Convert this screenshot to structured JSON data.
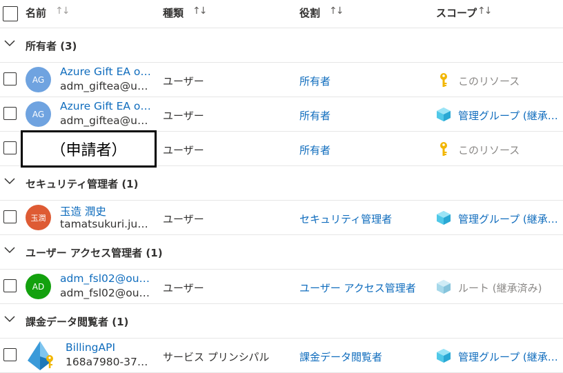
{
  "header": {
    "col_name": "名前",
    "col_type": "種類",
    "col_role": "役割",
    "col_scope": "スコープ",
    "sort_glyph": "↑↓"
  },
  "groups": [
    {
      "title": "所有者 (3)"
    },
    {
      "title": "セキュリティ管理者 (1)"
    },
    {
      "title": "ユーザー アクセス管理者 (1)"
    },
    {
      "title": "課金データ閲覧者 (1)"
    }
  ],
  "rows": [
    {
      "avatar": "AG",
      "avatar_color": "#6fa3e0",
      "name": "Azure Gift EA o…",
      "sub": "adm_giftea@u…",
      "type": "ユーザー",
      "role": "所有者",
      "scope_icon": "key-icon",
      "scope": "このリソース"
    },
    {
      "avatar": "AG",
      "avatar_color": "#6fa3e0",
      "name": "Azure Gift EA o…",
      "sub": "adm_giftea@u…",
      "type": "ユーザー",
      "role": "所有者",
      "scope_icon": "management-group-icon",
      "scope": "管理グループ (継承…"
    },
    {
      "redacted_label": "（申請者）",
      "type": "ユーザー",
      "role": "所有者",
      "scope_icon": "key-icon",
      "scope": "このリソース"
    },
    {
      "avatar": "玉潤",
      "avatar_color": "#de5b34",
      "name": "玉造 潤史",
      "sub": "tamatsukuri.ju…",
      "type": "ユーザー",
      "role": "セキュリティ管理者",
      "scope_icon": "management-group-icon",
      "scope": "管理グループ (継承…"
    },
    {
      "avatar": "AD",
      "avatar_color": "#13a10e",
      "name": "adm_fsl02@ou…",
      "sub": "adm_fsl02@ou…",
      "type": "ユーザー",
      "role": "ユーザー アクセス管理者",
      "scope_icon": "root-group-icon",
      "scope": "ルート (継承済み)"
    },
    {
      "avatar_icon": "service-principal-icon",
      "name": "BillingAPI",
      "sub": "168a7980-37…",
      "type": "サービス プリンシパル",
      "role": "課金データ閲覧者",
      "scope_icon": "management-group-icon",
      "scope": "管理グループ (継承…"
    }
  ]
}
